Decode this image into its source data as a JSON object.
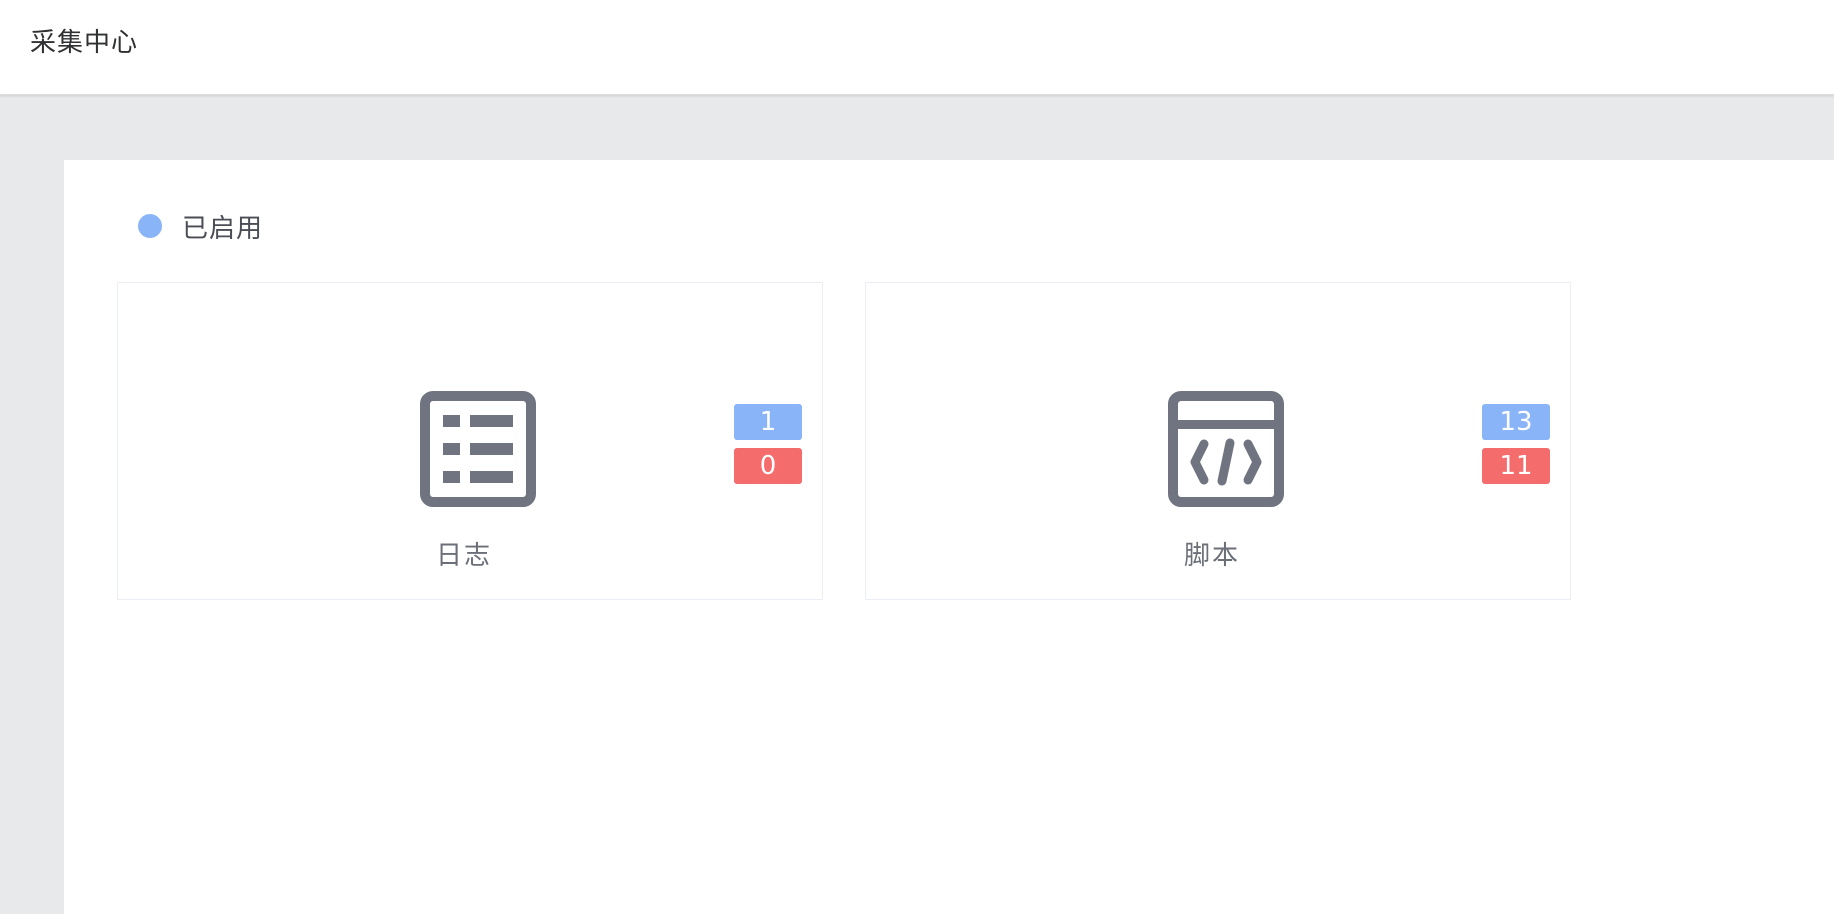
{
  "header": {
    "title": "采集中心"
  },
  "legend": {
    "label": "已启用",
    "color": "#8ab4f8"
  },
  "cards": [
    {
      "label": "日志",
      "icon": "list-document-icon",
      "enabled_count": "1",
      "disabled_count": "0"
    },
    {
      "label": "脚本",
      "icon": "code-window-icon",
      "enabled_count": "13",
      "disabled_count": "11"
    }
  ],
  "colors": {
    "enabled_badge": "#8ab4f8",
    "disabled_badge": "#f56c6c",
    "icon": "#6f7480"
  }
}
